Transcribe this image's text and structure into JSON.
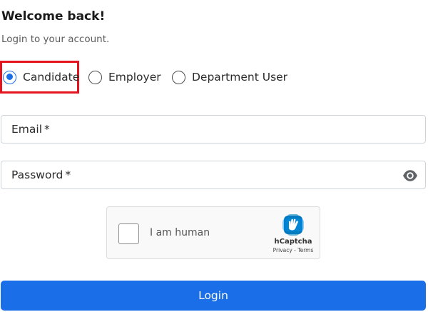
{
  "header": {
    "title": "Welcome back!",
    "subtitle": "Login to your account."
  },
  "roles": {
    "selected": "Candidate",
    "items": [
      "Candidate",
      "Employer",
      "Department User"
    ]
  },
  "form": {
    "email_label": "Email",
    "password_label": "Password",
    "required_marker": "*",
    "password_toggle_icon": "eye-icon"
  },
  "captcha": {
    "checkbox_label": "I am human",
    "brand": "hCaptcha",
    "links": "Privacy - Terms",
    "logo_icon": "hcaptcha-logo-icon"
  },
  "actions": {
    "login_label": "Login"
  },
  "colors": {
    "primary": "#1a6fe8",
    "highlight_border": "#e5131c",
    "captcha_logo": "#0074bf"
  }
}
